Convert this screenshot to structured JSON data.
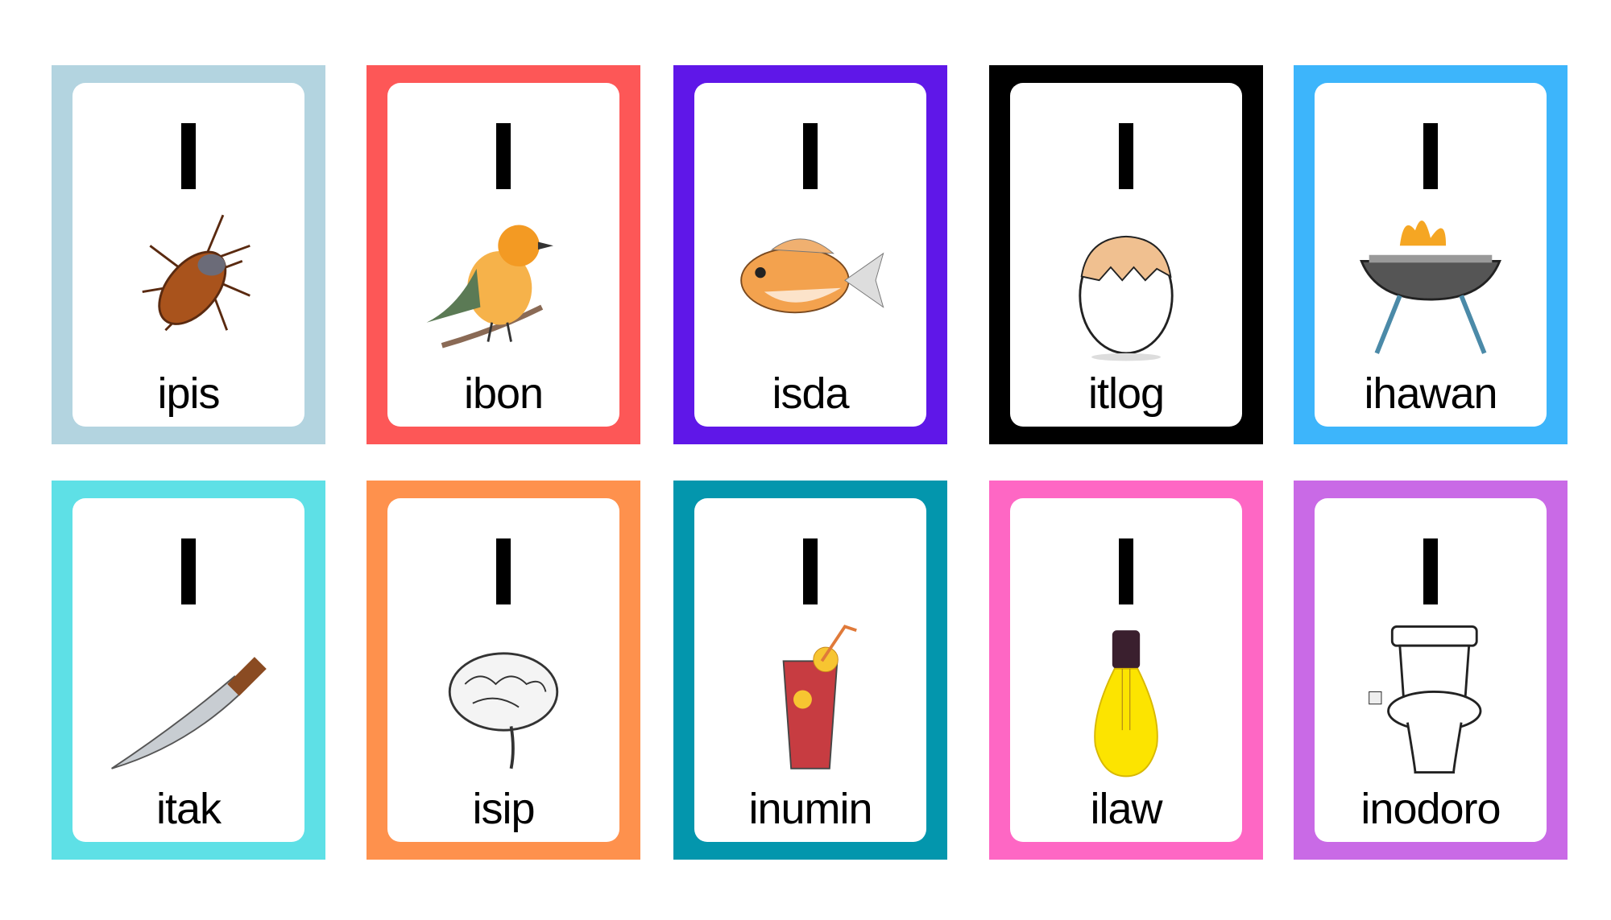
{
  "letter": "I",
  "cards": [
    {
      "word": "ipis",
      "color": "#b3d4e0",
      "icon": "cockroach-icon"
    },
    {
      "word": "ibon",
      "color": "#fd5757",
      "icon": "bird-icon"
    },
    {
      "word": "isda",
      "color": "#5f17e8",
      "icon": "fish-icon"
    },
    {
      "word": "itlog",
      "color": "#000000",
      "icon": "egg-icon"
    },
    {
      "word": "ihawan",
      "color": "#3db5fb",
      "icon": "grill-icon"
    },
    {
      "word": "itak",
      "color": "#5ee0e6",
      "icon": "machete-icon"
    },
    {
      "word": "isip",
      "color": "#fe914d",
      "icon": "brain-icon"
    },
    {
      "word": "inumin",
      "color": "#0396ad",
      "icon": "drink-icon"
    },
    {
      "word": "ilaw",
      "color": "#fe67c4",
      "icon": "lightbulb-icon"
    },
    {
      "word": "inodoro",
      "color": "#c96ae6",
      "icon": "toilet-icon"
    }
  ]
}
